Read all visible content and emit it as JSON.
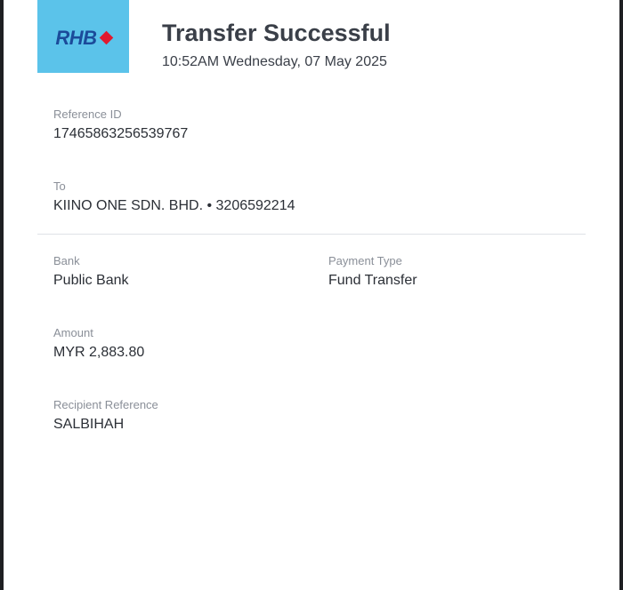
{
  "header": {
    "logo_text": "RHB",
    "title": "Transfer Successful",
    "timestamp": "10:52AM Wednesday, 07 May 2025"
  },
  "details": {
    "reference_id": {
      "label": "Reference ID",
      "value": "17465863256539767"
    },
    "to": {
      "label": "To",
      "value": "KIINO ONE SDN. BHD. • 3206592214"
    },
    "bank": {
      "label": "Bank",
      "value": "Public Bank"
    },
    "payment_type": {
      "label": "Payment Type",
      "value": "Fund Transfer"
    },
    "amount": {
      "label": "Amount",
      "value": "MYR 2,883.80"
    },
    "recipient_reference": {
      "label": "Recipient Reference",
      "value": "SALBIHAH"
    }
  },
  "colors": {
    "logo_background": "#5bc3ea",
    "logo_text": "#1b4b9a",
    "logo_diamond": "#e01a2f"
  }
}
